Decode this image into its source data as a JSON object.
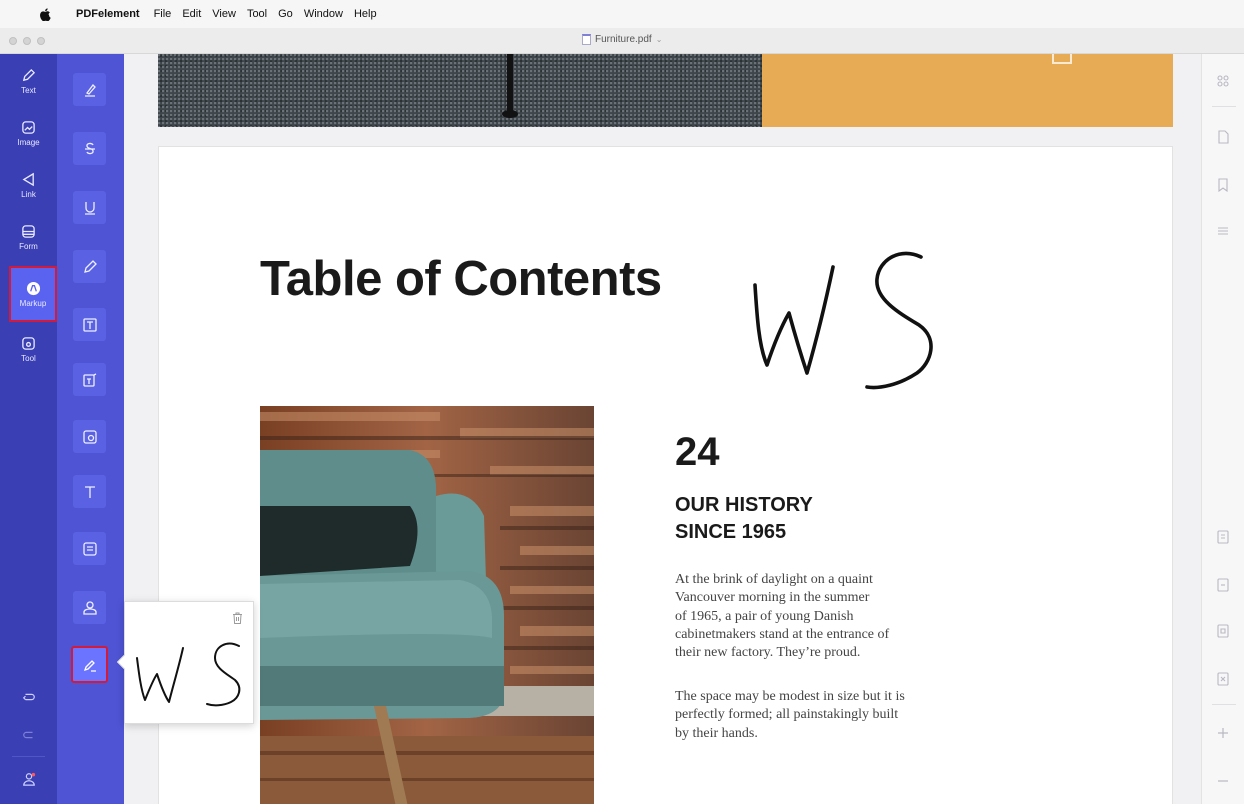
{
  "menubar": {
    "app_name": "PDFelement",
    "items": [
      "File",
      "Edit",
      "View",
      "Tool",
      "Go",
      "Window",
      "Help"
    ]
  },
  "titlebar": {
    "document_title": "Furniture.pdf"
  },
  "left_sidebar": {
    "items": [
      {
        "label": "Text",
        "icon": "pencil-icon"
      },
      {
        "label": "Image",
        "icon": "image-icon"
      },
      {
        "label": "Link",
        "icon": "link-icon"
      },
      {
        "label": "Form",
        "icon": "form-icon"
      },
      {
        "label": "Markup",
        "icon": "markup-icon",
        "active": true
      },
      {
        "label": "Tool",
        "icon": "tool-icon"
      }
    ],
    "accent": "#3a3fb4",
    "active_color": "#5a63ef",
    "highlight_border": "#d21a3a"
  },
  "markup_tools": [
    "highlight-icon",
    "strikethrough-icon",
    "underline-icon",
    "pencil-icon",
    "textbox-icon",
    "callout-icon",
    "note-icon",
    "typewriter-icon",
    "stamp-icon",
    "stamp-user-icon",
    "signature-icon"
  ],
  "document": {
    "toc_title": "Table of Contents",
    "signature_text": "WS",
    "number": "24",
    "history_line1": "OUR HISTORY",
    "history_line2": "SINCE 1965",
    "para1": [
      "At the brink of daylight on a quaint",
      "Vancouver morning in the summer",
      "of 1965, a pair of young Danish",
      "cabinetmakers stand at the entrance of",
      "their new factory. They’re proud."
    ],
    "para2": [
      "The space may be modest in size but it is",
      "perfectly formed; all painstakingly built",
      "by their hands."
    ]
  },
  "signature_popup": {
    "signature_text": "WS",
    "delete_icon": "trash-icon"
  },
  "right_sidebar": {
    "icons": [
      "thumbnails-icon",
      "page-icon",
      "bookmark-icon",
      "list-icon",
      "page-extract-icon",
      "page-insert-icon",
      "page-replace-icon",
      "page-crop-icon",
      "zoom-in-icon",
      "zoom-out-icon"
    ]
  }
}
